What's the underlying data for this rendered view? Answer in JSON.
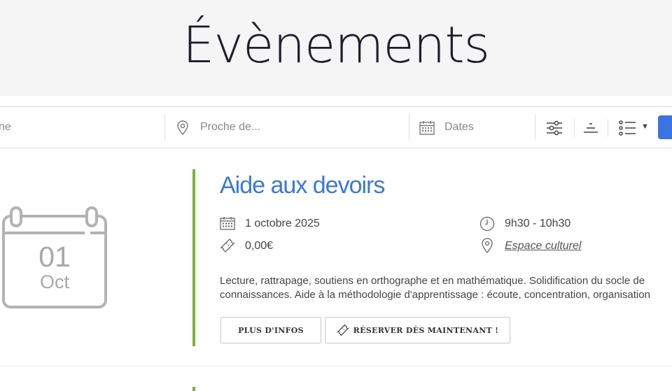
{
  "page": {
    "title": "Évènements"
  },
  "filters": {
    "keyword_partial": "ne",
    "location_placeholder": "Proche de...",
    "dates_placeholder": "Dates",
    "icons": [
      "map-pin-icon",
      "calendar-icon",
      "sliders-icon",
      "sort-icon",
      "list-view-icon",
      "caret-down-icon"
    ],
    "accent_color": "#3b73e3"
  },
  "event": {
    "day": "01",
    "month": "Oct",
    "title": "Aide aux devoirs",
    "date": "1 octobre 2025",
    "time": "9h30 - 10h30",
    "price": "0,00€",
    "location": "Espace culturel",
    "description_line1": "Lecture, rattrapage, soutiens en orthographe et en mathématique. Solidification du socle de",
    "description_line2": "connaissances. Aide à la méthodologie d'apprentissage : écoute, concentration, organisation",
    "more_info_label": "PLUS D'INFOS",
    "book_label": "RÉSERVER DÈS MAINTENANT !",
    "title_color": "#3a78d8",
    "accent_color": "#7fb03e"
  }
}
